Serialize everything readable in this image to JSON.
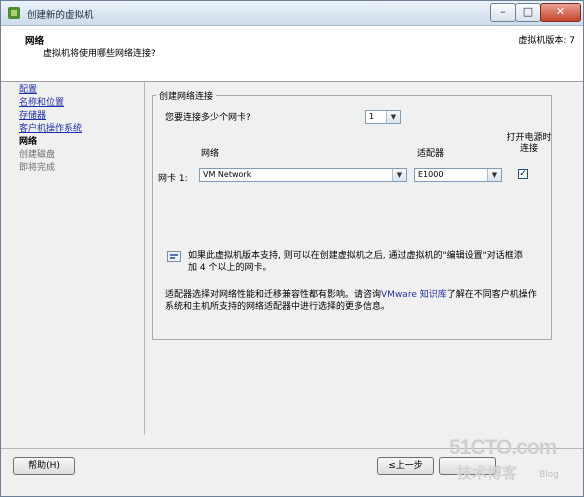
{
  "window": {
    "title": "创建新的虚拟机"
  },
  "titlebar_controls": {
    "minimize": "–",
    "maximize": "□",
    "close": "✕"
  },
  "header": {
    "title": "网络",
    "subtitle": "虚拟机将使用哪些网络连接?",
    "version": "虚拟机版本: 7"
  },
  "nav": [
    {
      "label": "配置",
      "state": "link"
    },
    {
      "label": "名称和位置",
      "state": "link"
    },
    {
      "label": "存储器",
      "state": "link"
    },
    {
      "label": "客户机操作系统",
      "state": "link"
    },
    {
      "label": "网络",
      "state": "current"
    },
    {
      "label": "创建磁盘",
      "state": "disabled"
    },
    {
      "label": "即将完成",
      "state": "disabled"
    }
  ],
  "group": {
    "title": "创建网络连接",
    "nic_count_question": "您要连接多少个网卡?",
    "nic_count_value": "1",
    "columns": {
      "network": "网络",
      "adapter": "适配器",
      "power_on": "打开电源时连接"
    },
    "nic_row": {
      "label": "网卡 1:",
      "network": "VM Network",
      "adapter": "E1000",
      "connect_at_power_on": true
    },
    "info_text": "如果此虚拟机版本支持, 则可以在创建虚拟机之后, 通过虚拟机的\"编辑设置\"对话框添加 4 个以上的网卡。",
    "note_prefix": "适配器选择对网络性能和迁移兼容性都有影响。请咨询",
    "note_link": "VMware 知识库",
    "note_suffix": "了解在不同客户机操作系统和主机所支持的网络适配器中进行选择的更多信息。"
  },
  "buttons": {
    "help": "帮助(H)",
    "back": "≤上一步"
  },
  "watermark": {
    "line1": "51CTO.com",
    "line2": "技术博客",
    "line3": "Blog"
  }
}
